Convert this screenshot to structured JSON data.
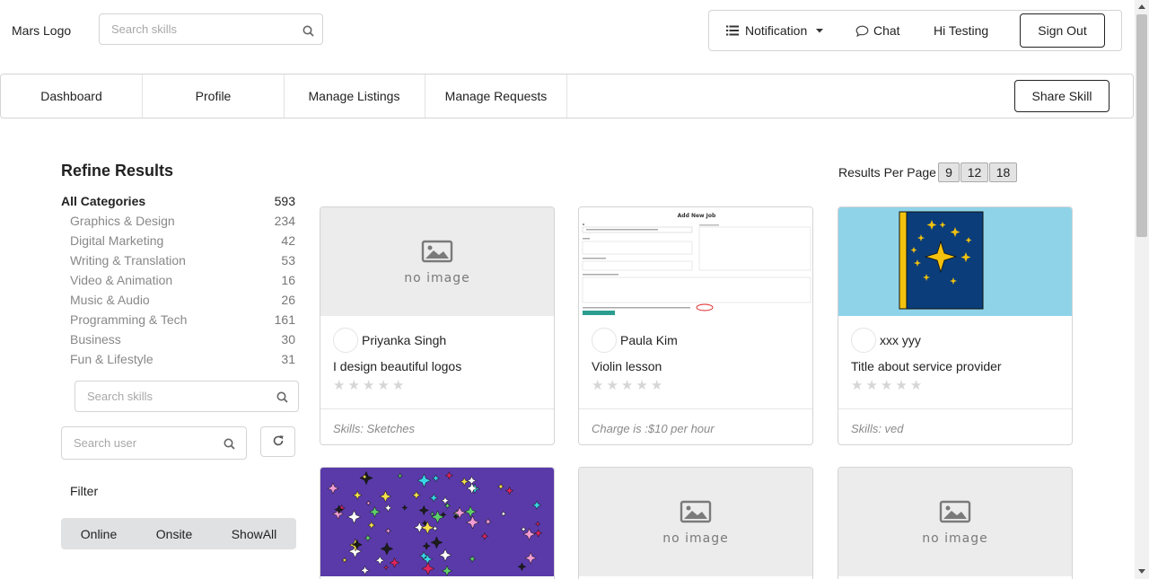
{
  "header": {
    "logo": "Mars Logo",
    "search_placeholder": "Search skills",
    "notification_label": "Notification",
    "chat_label": "Chat",
    "greeting": "Hi Testing",
    "signout_label": "Sign Out"
  },
  "tabs": {
    "items": [
      {
        "label": "Dashboard"
      },
      {
        "label": "Profile"
      },
      {
        "label": "Manage Listings"
      },
      {
        "label": "Manage Requests"
      }
    ],
    "share_label": "Share Skill"
  },
  "sidebar": {
    "title": "Refine Results",
    "all_categories": {
      "label": "All Categories",
      "count": "593"
    },
    "categories": [
      {
        "label": "Graphics & Design",
        "count": "234"
      },
      {
        "label": "Digital Marketing",
        "count": "42"
      },
      {
        "label": "Writing & Translation",
        "count": "53"
      },
      {
        "label": "Video & Animation",
        "count": "16"
      },
      {
        "label": "Music & Audio",
        "count": "26"
      },
      {
        "label": "Programming & Tech",
        "count": "161"
      },
      {
        "label": "Business",
        "count": "30"
      },
      {
        "label": "Fun & Lifestyle",
        "count": "31"
      }
    ],
    "skill_search_placeholder": "Search skills",
    "user_search_placeholder": "Search user",
    "filter_label": "Filter",
    "filter_options": [
      "Online",
      "Onsite",
      "ShowAll"
    ]
  },
  "results": {
    "per_page_label": "Results Per Page :",
    "per_page_options": [
      "9",
      "12",
      "18"
    ]
  },
  "no_image_text": "no image",
  "screenshot_text": "Add New Job",
  "cards": [
    {
      "user": "Priyanka Singh",
      "title": "I design beautiful logos",
      "footer": "Skills: Sketches",
      "image": "no-image",
      "rating": 0
    },
    {
      "user": "Paula Kim",
      "title": "Violin lesson",
      "footer": "Charge is :$10 per hour",
      "image": "form-screenshot",
      "rating": 0
    },
    {
      "user": "xxx yyy",
      "title": "Title about service provider",
      "footer": "Skills: ved",
      "image": "star-book",
      "rating": 0
    },
    {
      "image": "sparkles"
    },
    {
      "image": "no-image"
    },
    {
      "image": "no-image"
    }
  ],
  "colors": {
    "sky_blue": "#8fd3e8",
    "navy": "#0b3d7a",
    "gold": "#f4c20d",
    "purple": "#5a3aa8"
  }
}
